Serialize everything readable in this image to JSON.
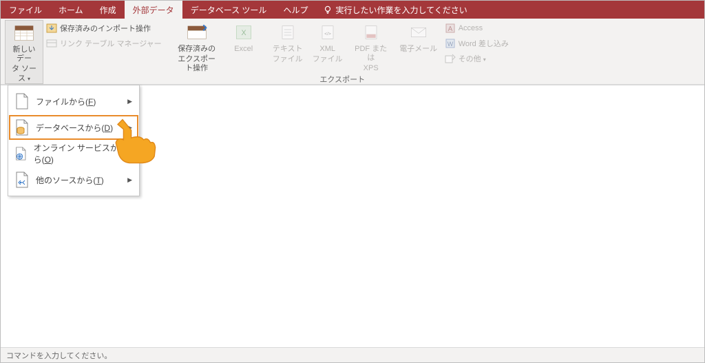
{
  "tabs": {
    "file": "ファイル",
    "home": "ホーム",
    "create": "作成",
    "external": "外部データ",
    "dbtools": "データベース ツール",
    "help": "ヘルプ",
    "tellme": "実行したい作業を入力してください"
  },
  "ribbon": {
    "new_source_l1": "新しいデー",
    "new_source_l2": "タ ソース",
    "saved_import": "保存済みのインポート操作",
    "link_tbl_mgr": "リンク テーブル マネージャー",
    "saved_export_l1": "保存済みの",
    "saved_export_l2": "エクスポート操作",
    "excel": "Excel",
    "text_l1": "テキスト",
    "text_l2": "ファイル",
    "xml_l1": "XML",
    "xml_l2": "ファイル",
    "pdf_l1": "PDF または",
    "pdf_l2": "XPS",
    "email": "電子メール",
    "access": "Access",
    "word_merge": "Word 差し込み",
    "other": "その他",
    "group_export": "エクスポート"
  },
  "menu": {
    "file_pre": "ファイルから(",
    "file_u": "F",
    "close": ")",
    "db_pre": "データベースから(",
    "db_u": "D",
    "online_pre": "オンライン サービスから(",
    "online_u": "O",
    "other_pre": "他のソースから(",
    "other_u": "T"
  },
  "status": "コマンドを入力してください。"
}
